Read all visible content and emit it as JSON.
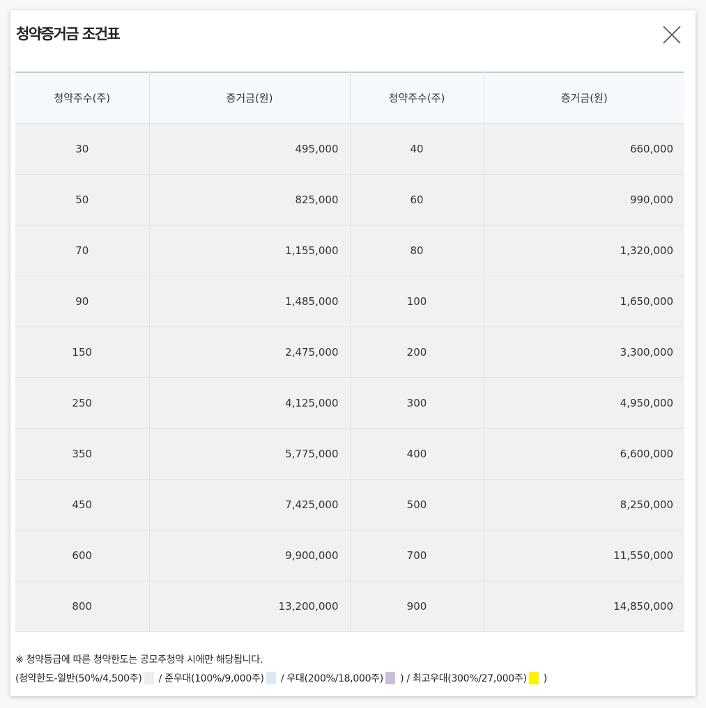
{
  "modal": {
    "title": "청약증거금 조건표",
    "close_label": "close"
  },
  "table": {
    "headers": [
      "청약주수(주)",
      "증거금(원)",
      "청약주수(주)",
      "증거금(원)"
    ],
    "rows": [
      [
        "30",
        "495,000",
        "40",
        "660,000"
      ],
      [
        "50",
        "825,000",
        "60",
        "990,000"
      ],
      [
        "70",
        "1,155,000",
        "80",
        "1,320,000"
      ],
      [
        "90",
        "1,485,000",
        "100",
        "1,650,000"
      ],
      [
        "150",
        "2,475,000",
        "200",
        "3,300,000"
      ],
      [
        "250",
        "4,125,000",
        "300",
        "4,950,000"
      ],
      [
        "350",
        "5,775,000",
        "400",
        "6,600,000"
      ],
      [
        "450",
        "7,425,000",
        "500",
        "8,250,000"
      ],
      [
        "600",
        "9,900,000",
        "700",
        "11,550,000"
      ],
      [
        "800",
        "13,200,000",
        "900",
        "14,850,000"
      ]
    ]
  },
  "footnote": {
    "line1": "※ 청약등급에 따른 청약한도는 공모주청약 시에만 해당됩니다.",
    "general": "(청약한도-일반(50%/4,500주)",
    "semi_preferred": "/ 준우대(100%/9,000주)",
    "preferred": "/ 우대(200%/18,000주)",
    "top_preferred": ") / 최고우대(300%/27,000주)",
    "close_paren": ")"
  },
  "colors": {
    "general": "#eeeeee",
    "semi_preferred": "#d8eaf3",
    "preferred": "#c9bfdc",
    "top_preferred": "#fff200"
  }
}
